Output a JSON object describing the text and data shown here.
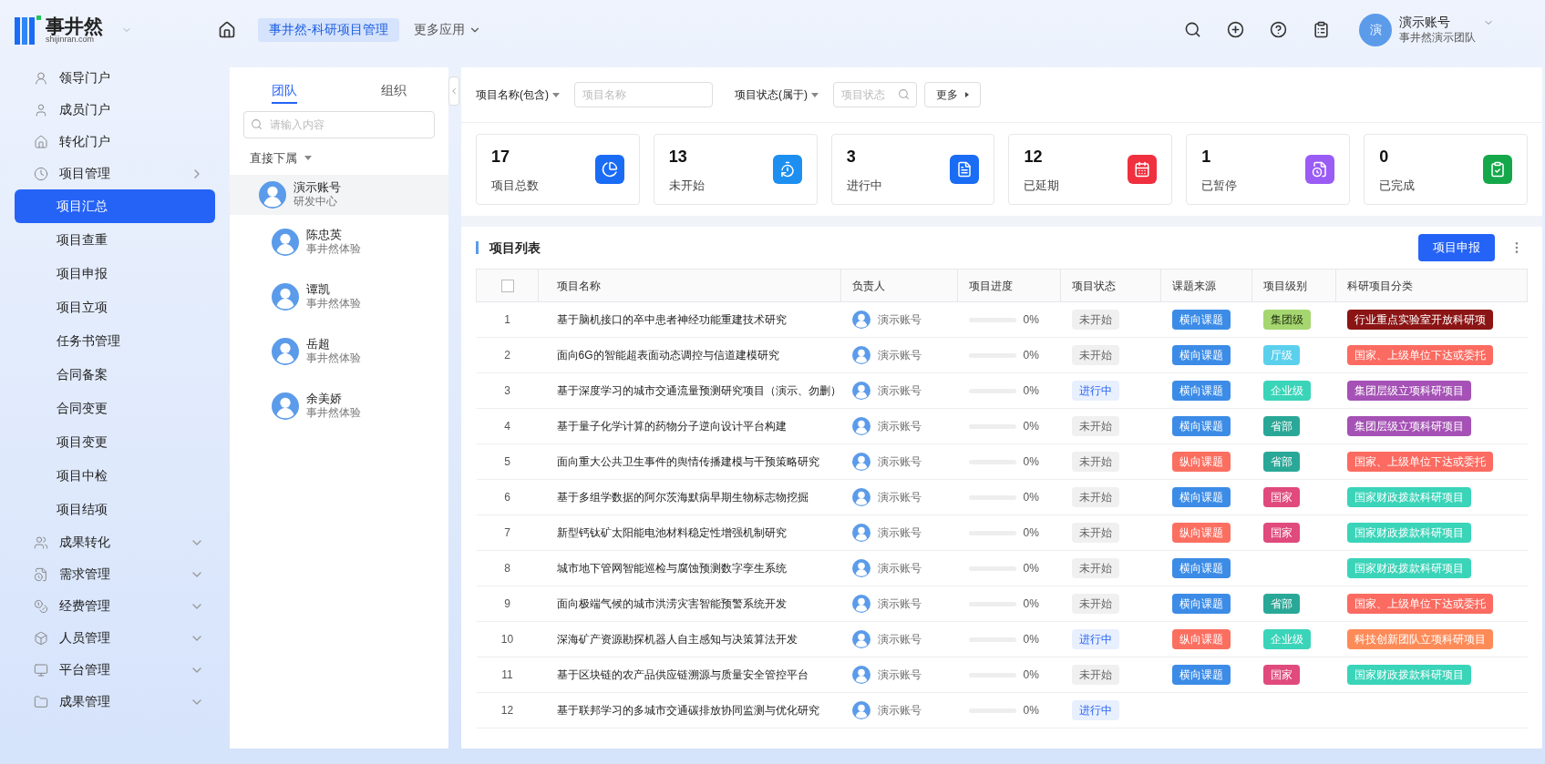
{
  "header": {
    "logo_text": "事井然",
    "logo_domain": "shijinran.com",
    "apps": [
      {
        "label": "事井然-科研项目管理",
        "selected": true
      }
    ],
    "more_apps": "更多应用",
    "user": {
      "avatar": "演",
      "name": "演示账号",
      "team": "事井然演示团队"
    }
  },
  "sidebar": {
    "items": [
      {
        "label": "领导门户"
      },
      {
        "label": "成员门户"
      },
      {
        "label": "转化门户"
      },
      {
        "label": "项目管理",
        "expanded": true,
        "children": [
          {
            "label": "项目汇总",
            "selected": true
          },
          {
            "label": "项目查重",
            "selected": false
          },
          {
            "label": "项目申报",
            "selected": false
          },
          {
            "label": "项目立项",
            "selected": false
          },
          {
            "label": "任务书管理",
            "selected": false
          },
          {
            "label": "合同备案",
            "selected": false
          },
          {
            "label": "合同变更",
            "selected": false
          },
          {
            "label": "项目变更",
            "selected": false
          },
          {
            "label": "项目中检",
            "selected": false
          },
          {
            "label": "项目结项",
            "selected": false
          }
        ]
      },
      {
        "label": "成果转化",
        "expanded": false
      },
      {
        "label": "需求管理",
        "expanded": false
      },
      {
        "label": "经费管理",
        "expanded": false
      },
      {
        "label": "人员管理",
        "expanded": false
      },
      {
        "label": "平台管理",
        "expanded": false
      },
      {
        "label": "成果管理",
        "expanded": false
      }
    ]
  },
  "org_panel": {
    "tabs": [
      {
        "label": "团队",
        "selected": true
      },
      {
        "label": "组织",
        "selected": false
      }
    ],
    "search": {
      "placeholder": "请输入内容"
    },
    "filter": "直接下属",
    "members": [
      {
        "name": "演示账号",
        "dept": "研发中心",
        "selected": true,
        "children": [
          {
            "name": "陈忠英",
            "dept": "事井然体验",
            "selected": false
          },
          {
            "name": "谭凯",
            "dept": "事井然体验",
            "selected": false
          },
          {
            "name": "岳超",
            "dept": "事井然体验",
            "selected": false
          },
          {
            "name": "余美娇",
            "dept": "事井然体验",
            "selected": false
          }
        ]
      }
    ]
  },
  "filters": {
    "fields": [
      {
        "label": "项目名称(包含)",
        "placeholder": "项目名称",
        "search": false
      },
      {
        "label": "项目状态(属于)",
        "placeholder": "项目状态",
        "search": true
      }
    ],
    "more": "更多"
  },
  "stats": [
    {
      "value": "17",
      "label": "项目总数",
      "color": "#1a6cf5"
    },
    {
      "value": "13",
      "label": "未开始",
      "color": "#1c8ff0"
    },
    {
      "value": "3",
      "label": "进行中",
      "color": "#1a6cf5"
    },
    {
      "value": "12",
      "label": "已延期",
      "color": "#f0303f"
    },
    {
      "value": "1",
      "label": "已暂停",
      "color": "#9a5cf5"
    },
    {
      "value": "0",
      "label": "已完成",
      "color": "#14a84b"
    }
  ],
  "table": {
    "title": "项目列表",
    "select_all": {
      "checked": false
    },
    "action": "项目申报",
    "columns": [
      "项目名称",
      "负责人",
      "项目进度",
      "项目状态",
      "课题来源",
      "项目级别",
      "科研项目分类"
    ],
    "rows": [
      {
        "no": "1",
        "name": "基于脑机接口的卒中患者神经功能重建技术研究",
        "owner": "演示账号",
        "level": 0,
        "progress": "0%",
        "status": {
          "text": "未开始",
          "kind": "pending"
        },
        "source": {
          "text": "横向课题",
          "color": "#3c8ce7"
        },
        "grade": {
          "text": "集团级",
          "color": "#a5d66f"
        },
        "category": {
          "text": "行业重点实验室开放科研项",
          "color": "#8b1414"
        }
      },
      {
        "no": "2",
        "name": "面向6G的智能超表面动态调控与信道建模研究",
        "owner": "演示账号",
        "level": 0,
        "progress": "0%",
        "status": {
          "text": "未开始",
          "kind": "pending"
        },
        "source": {
          "text": "横向课题",
          "color": "#3c8ce7"
        },
        "grade": {
          "text": "厅级",
          "color": "#5bd0ec"
        },
        "category": {
          "text": "国家、上级单位下达或委托",
          "color": "#fb6b61"
        }
      },
      {
        "no": "3",
        "name": "基于深度学习的城市交通流量预测研究项目（演示、勿删）",
        "owner": "演示账号",
        "level": 0,
        "progress": "0%",
        "status": {
          "text": "进行中",
          "kind": "active"
        },
        "source": {
          "text": "横向课题",
          "color": "#3c8ce7"
        },
        "grade": {
          "text": "企业级",
          "color": "#3ad4b9"
        },
        "category": {
          "text": "集团层级立项科研项目",
          "color": "#a551b5"
        }
      },
      {
        "no": "4",
        "name": "基于量子化学计算的药物分子逆向设计平台构建",
        "owner": "演示账号",
        "level": 0,
        "progress": "0%",
        "status": {
          "text": "未开始",
          "kind": "pending"
        },
        "source": {
          "text": "横向课题",
          "color": "#3c8ce7"
        },
        "grade": {
          "text": "省部",
          "color": "#2aa897"
        },
        "category": {
          "text": "集团层级立项科研项目",
          "color": "#a551b5"
        }
      },
      {
        "no": "5",
        "name": "面向重大公共卫生事件的舆情传播建模与干预策略研究",
        "owner": "演示账号",
        "level": 0,
        "progress": "0%",
        "status": {
          "text": "未开始",
          "kind": "pending"
        },
        "source": {
          "text": "纵向课题",
          "color": "#fb6f61"
        },
        "grade": {
          "text": "省部",
          "color": "#2aa897"
        },
        "category": {
          "text": "国家、上级单位下达或委托",
          "color": "#fb6b61"
        }
      },
      {
        "no": "6",
        "name": "基于多组学数据的阿尔茨海默病早期生物标志物挖掘",
        "owner": "演示账号",
        "level": 0,
        "progress": "0%",
        "status": {
          "text": "未开始",
          "kind": "pending"
        },
        "source": {
          "text": "横向课题",
          "color": "#3c8ce7"
        },
        "grade": {
          "text": "国家",
          "color": "#e04a7c"
        },
        "category": {
          "text": "国家财政拨款科研项目",
          "color": "#3ad4b9"
        }
      },
      {
        "no": "7",
        "name": "新型钙钛矿太阳能电池材料稳定性增强机制研究",
        "owner": "演示账号",
        "level": 0,
        "progress": "0%",
        "status": {
          "text": "未开始",
          "kind": "pending"
        },
        "source": {
          "text": "纵向课题",
          "color": "#fb6f61"
        },
        "grade": {
          "text": "国家",
          "color": "#e04a7c"
        },
        "category": {
          "text": "国家财政拨款科研项目",
          "color": "#3ad4b9"
        }
      },
      {
        "no": "8",
        "name": "城市地下管网智能巡检与腐蚀预测数字孪生系统",
        "owner": "演示账号",
        "level": 0,
        "progress": "0%",
        "status": {
          "text": "未开始",
          "kind": "pending"
        },
        "source": {
          "text": "横向课题",
          "color": "#3c8ce7"
        },
        "category": {
          "text": "国家财政拨款科研项目",
          "color": "#3ad4b9"
        }
      },
      {
        "no": "9",
        "name": "面向极端气候的城市洪涝灾害智能预警系统开发",
        "owner": "演示账号",
        "level": 0,
        "progress": "0%",
        "status": {
          "text": "未开始",
          "kind": "pending"
        },
        "source": {
          "text": "横向课题",
          "color": "#3c8ce7"
        },
        "grade": {
          "text": "省部",
          "color": "#2aa897"
        },
        "category": {
          "text": "国家、上级单位下达或委托",
          "color": "#fb6b61"
        }
      },
      {
        "no": "10",
        "name": "深海矿产资源勘探机器人自主感知与决策算法开发",
        "owner": "演示账号",
        "level": 0,
        "progress": "0%",
        "status": {
          "text": "进行中",
          "kind": "active"
        },
        "source": {
          "text": "纵向课题",
          "color": "#fb6f61"
        },
        "grade": {
          "text": "企业级",
          "color": "#3ad4b9"
        },
        "category": {
          "text": "科技创新团队立项科研项目",
          "color": "#fd8b58"
        }
      },
      {
        "no": "11",
        "name": "基于区块链的农产品供应链溯源与质量安全管控平台",
        "owner": "演示账号",
        "level": 0,
        "progress": "0%",
        "status": {
          "text": "未开始",
          "kind": "pending"
        },
        "source": {
          "text": "横向课题",
          "color": "#3c8ce7"
        },
        "grade": {
          "text": "国家",
          "color": "#e04a7c"
        },
        "category": {
          "text": "国家财政拨款科研项目",
          "color": "#3ad4b9"
        }
      },
      {
        "no": "12",
        "name": "基于联邦学习的多城市交通碳排放协同监测与优化研究",
        "owner": "演示账号",
        "level": 0,
        "progress": "0%",
        "status": {
          "text": "进行中",
          "kind": "active"
        }
      }
    ]
  }
}
